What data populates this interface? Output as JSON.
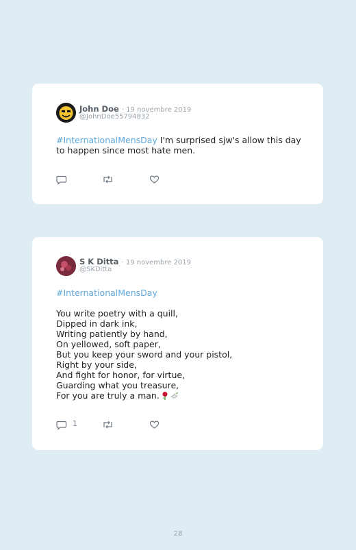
{
  "tweets": [
    {
      "name": "John Doe",
      "date": "· 19 novembre 2019",
      "handle": "@JohnDoe55794832",
      "avatar_icon": "smiley-face-avatar",
      "hashtag": "#InternationalMensDay",
      "text_rest": " I'm surprised sjw's allow this day to happen since most hate men.",
      "reply_count": "",
      "icons": [
        "reply-icon",
        "retweet-icon",
        "like-icon"
      ]
    },
    {
      "name": "S K Ditta",
      "date": "· 19 novembre 2019",
      "handle": "@SKDitta",
      "avatar_icon": "photo-avatar",
      "hashtag": "#InternationalMensDay",
      "poem": [
        "You write poetry with a quill,",
        "Dipped in dark ink,",
        "Writing patiently by hand,",
        "On yellowed, soft paper,",
        "But you keep your sword and your pistol,",
        "Right by your side,",
        "And fight for honor, for virtue,",
        "Guarding what you treasure,",
        "For you are truly a man."
      ],
      "emoji": [
        "rose-icon",
        "dove-icon"
      ],
      "reply_count": "1",
      "icons": [
        "reply-icon",
        "retweet-icon",
        "like-icon"
      ]
    }
  ],
  "page_number": "28",
  "colors": {
    "background": "#dfecf4",
    "hashtag": "#5fa9dd",
    "icon": "#6b7580"
  }
}
